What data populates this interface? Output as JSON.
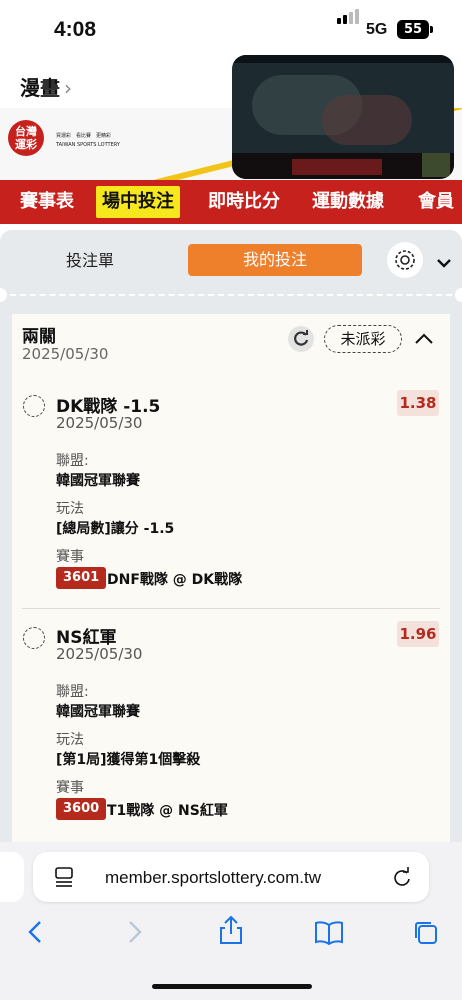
{
  "status_bar": {
    "time": "4:08",
    "network": "5G",
    "battery": "55"
  },
  "header": {
    "back_label": "漫畫",
    "back_chevron": "›"
  },
  "logo": {
    "line1": "台灣",
    "line2": "運彩",
    "text1": "買運彩　看比賽　更精彩",
    "text2": "TAIWAN SPORTS LOTTERY"
  },
  "nav": {
    "items": [
      {
        "label": "賽事表"
      },
      {
        "label": "場中投注",
        "active": true
      },
      {
        "label": "即時比分"
      },
      {
        "label": "運動數據"
      },
      {
        "label": "會員"
      }
    ]
  },
  "tabs": {
    "bet_slip": "投注單",
    "my_bets": "我的投注"
  },
  "bet": {
    "title": "兩關",
    "date": "2025/05/30",
    "status": "未派彩",
    "picks": [
      {
        "name": "DK戰隊 -1.5",
        "date": "2025/05/30",
        "odds": "1.38",
        "league_label": "聯盟:",
        "league": "韓國冠軍聯賽",
        "play_label": "玩法",
        "play": "[總局數]讓分 -1.5",
        "event_label": "賽事",
        "event_id": "3601",
        "match": "DNF戰隊 @ DK戰隊"
      },
      {
        "name": "NS紅軍",
        "date": "2025/05/30",
        "odds": "1.96",
        "league_label": "聯盟:",
        "league": "韓國冠軍聯賽",
        "play_label": "玩法",
        "play": "[第1局]獲得第1個擊殺",
        "event_label": "賽事",
        "event_id": "3600",
        "match": "T1戰隊 @ NS紅軍"
      }
    ]
  },
  "browser": {
    "url": "member.sportslottery.com.tw"
  },
  "colors": {
    "brand_red": "#c7211d",
    "active_tab_orange": "#ee7f2b",
    "nav_highlight": "#f6e81c"
  }
}
